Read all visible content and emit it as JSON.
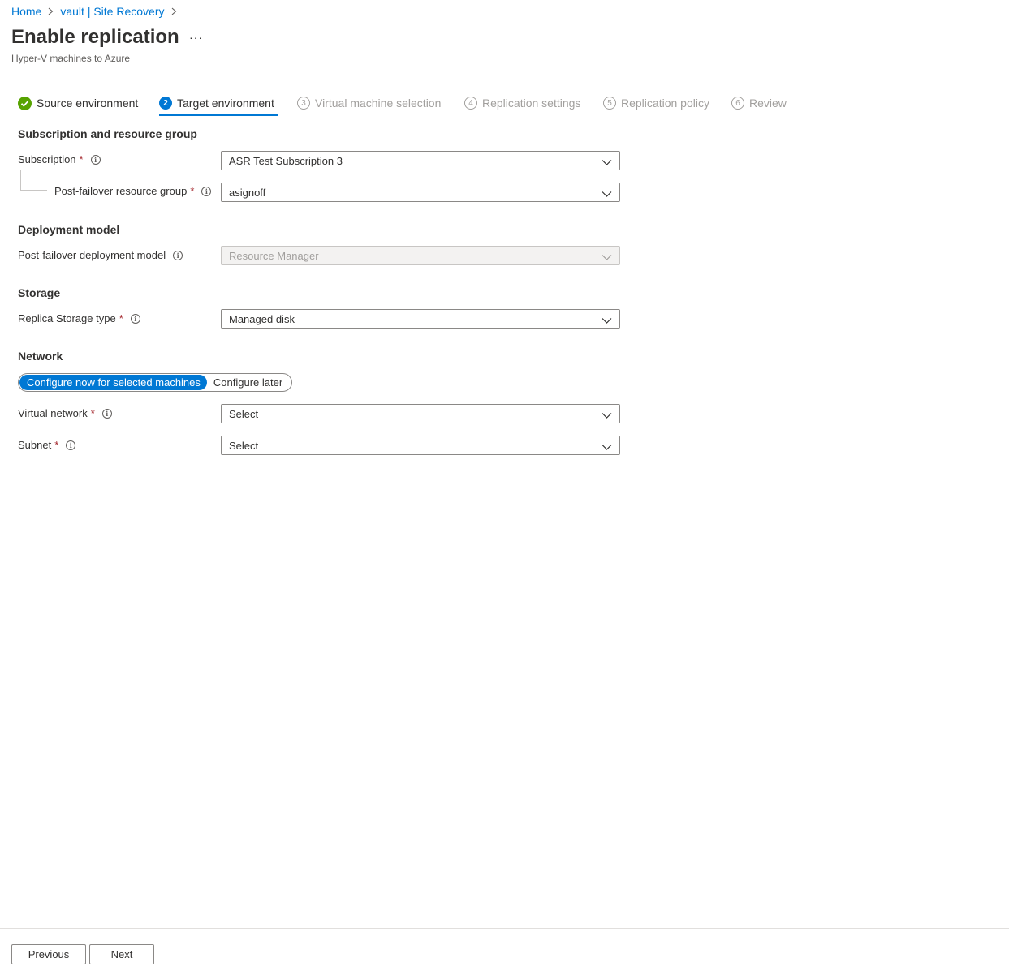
{
  "breadcrumb": {
    "items": [
      "Home",
      "vault | Site Recovery"
    ]
  },
  "header": {
    "title": "Enable replication",
    "more_label": "···",
    "subtitle": "Hyper-V machines to Azure"
  },
  "tabs": [
    {
      "label": "Source environment",
      "step": "",
      "state": "complete"
    },
    {
      "label": "Target environment",
      "step": "2",
      "state": "active"
    },
    {
      "label": "Virtual machine selection",
      "step": "3",
      "state": "pending"
    },
    {
      "label": "Replication settings",
      "step": "4",
      "state": "pending"
    },
    {
      "label": "Replication policy",
      "step": "5",
      "state": "pending"
    },
    {
      "label": "Review",
      "step": "6",
      "state": "pending"
    }
  ],
  "sections": {
    "subscription": {
      "heading": "Subscription and resource group",
      "subscription_label": "Subscription",
      "subscription_value": "ASR Test Subscription 3",
      "resource_group_label": "Post-failover resource group",
      "resource_group_value": "asignoff"
    },
    "deployment": {
      "heading": "Deployment model",
      "model_label": "Post-failover deployment model",
      "model_value": "Resource Manager"
    },
    "storage": {
      "heading": "Storage",
      "type_label": "Replica Storage type",
      "type_value": "Managed disk"
    },
    "network": {
      "heading": "Network",
      "toggle_on": "Configure now for selected machines",
      "toggle_off": "Configure later",
      "vnet_label": "Virtual network",
      "vnet_value": "Select",
      "subnet_label": "Subnet",
      "subnet_value": "Select"
    }
  },
  "required_marker": "*",
  "info_glyph": "i",
  "footer": {
    "previous_label": "Previous",
    "next_label": "Next"
  },
  "colors": {
    "accent": "#0078d4",
    "success": "#57a300",
    "required": "#a4262c",
    "text": "#323130",
    "muted": "#a19f9d"
  }
}
